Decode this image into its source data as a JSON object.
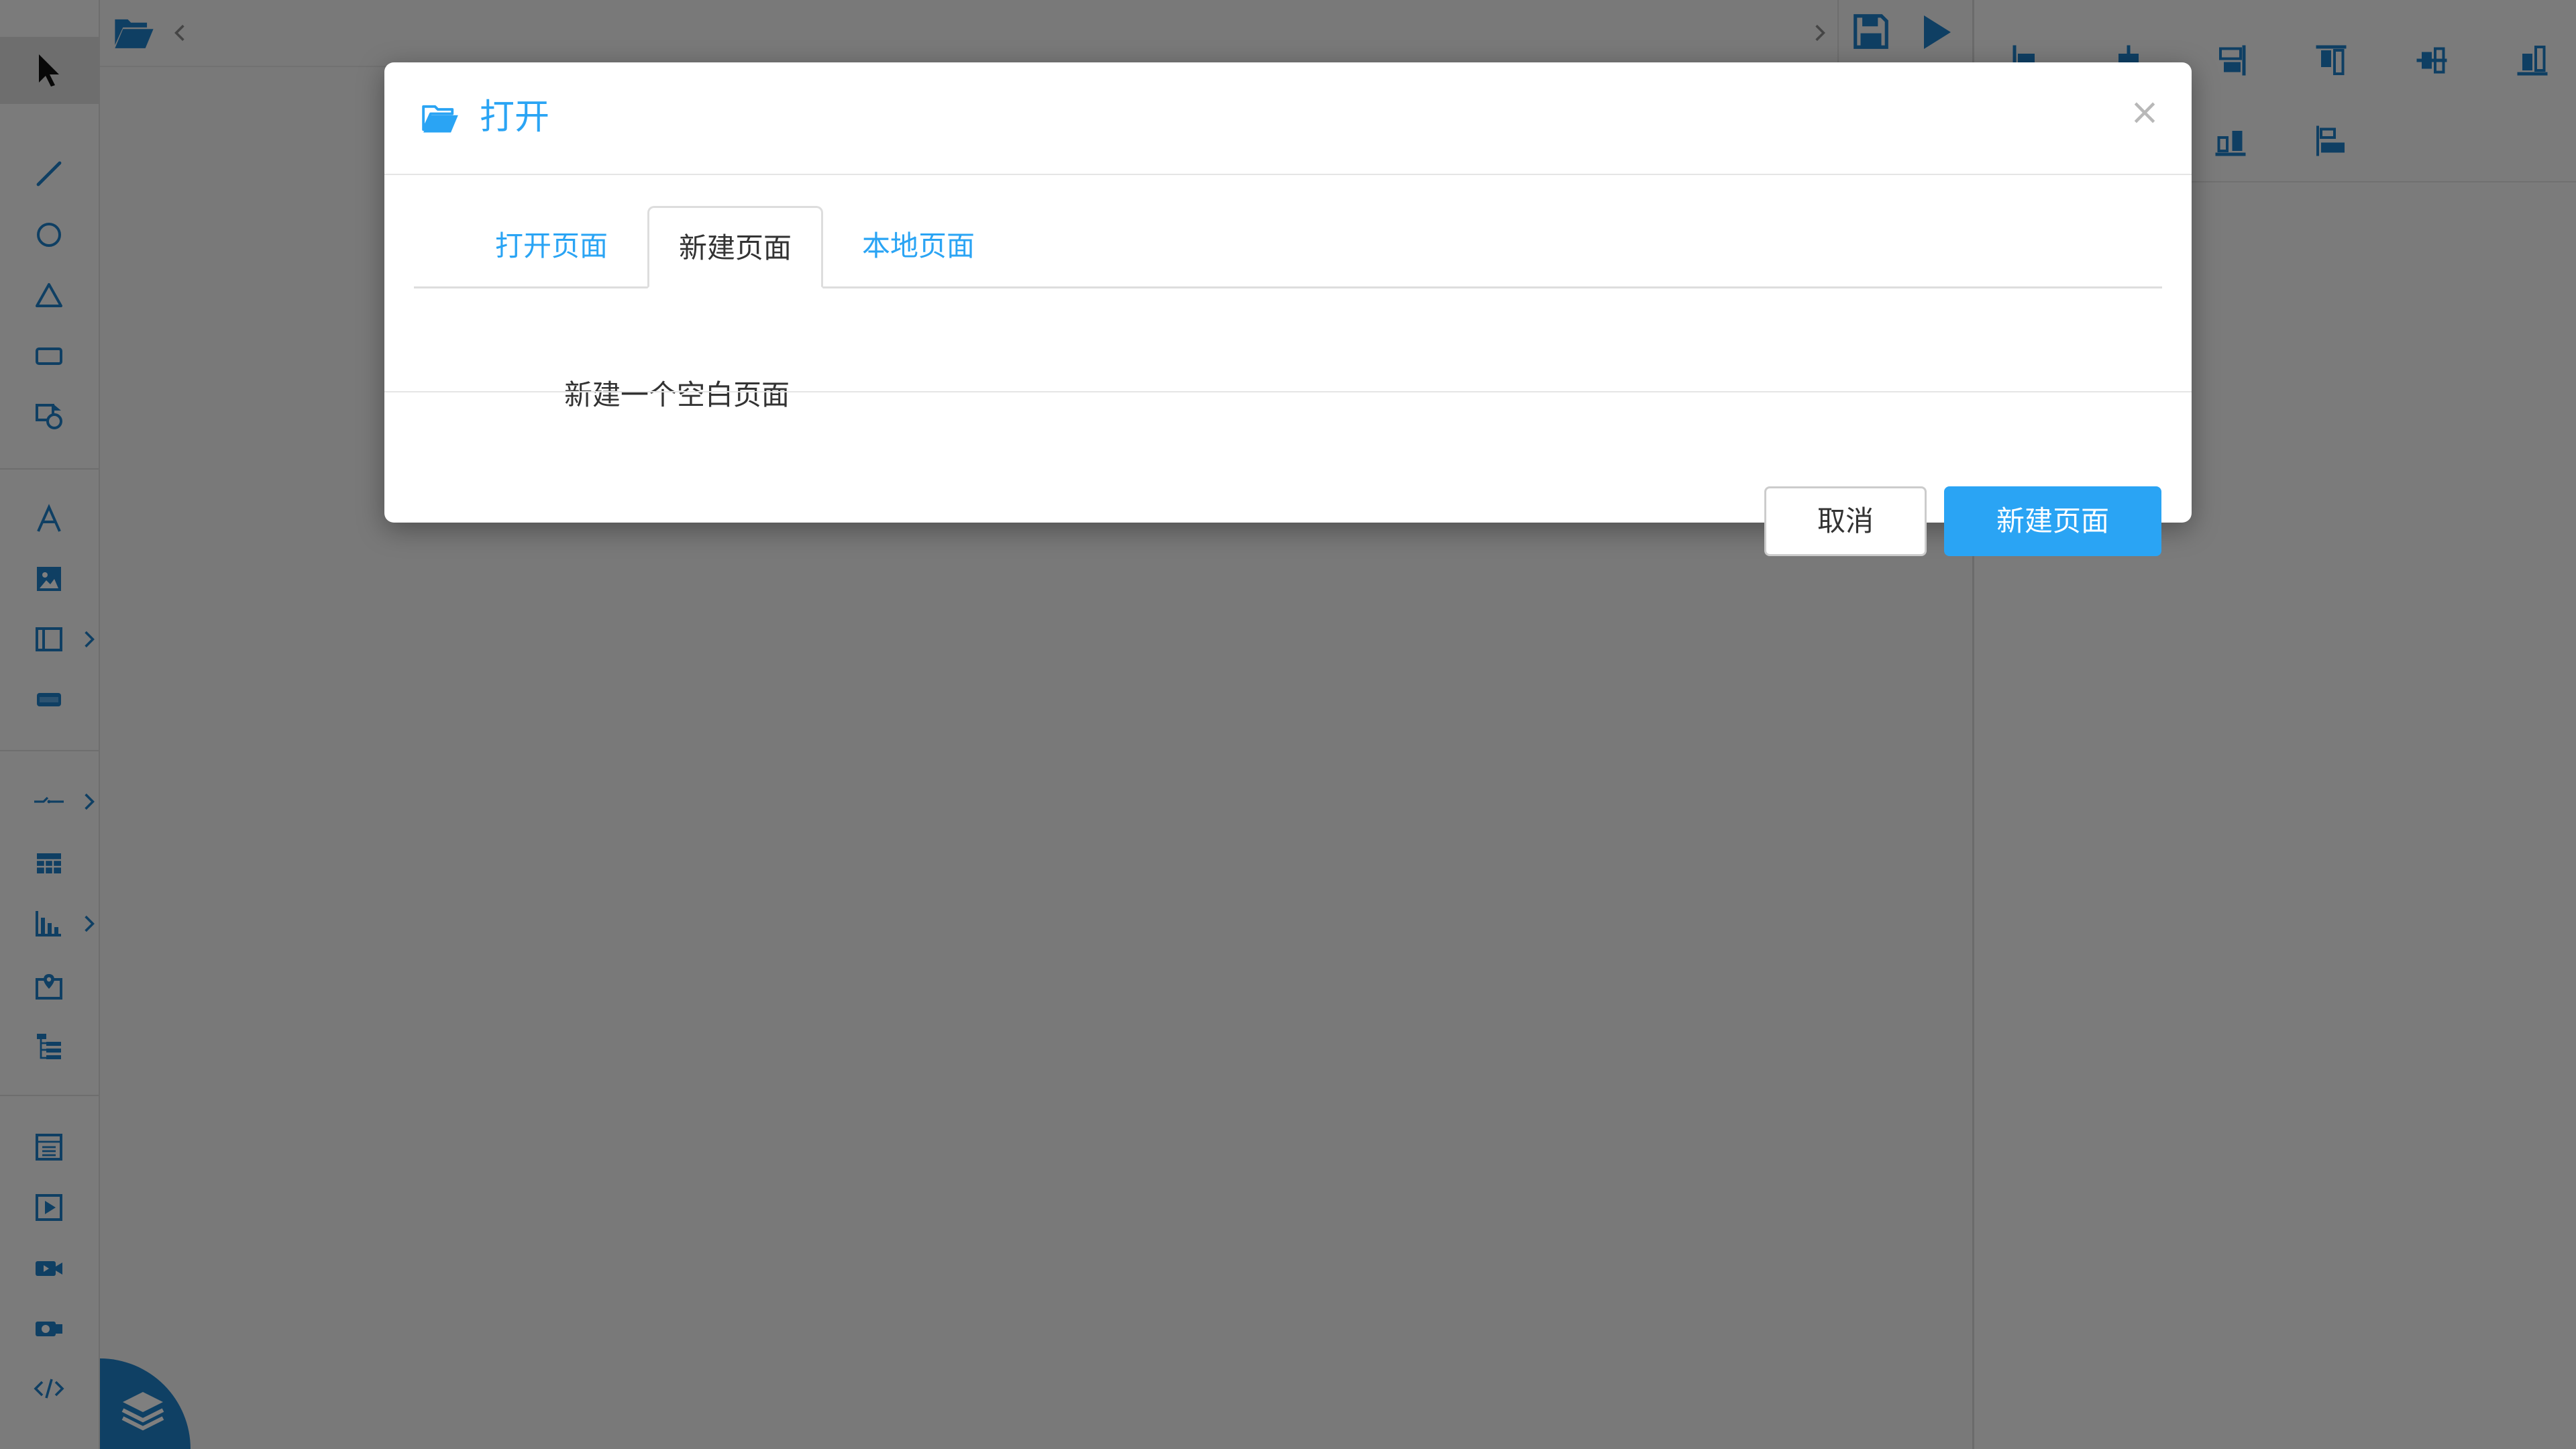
{
  "modal": {
    "title": "打开",
    "close_symbol": "×",
    "tabs": [
      {
        "label": "打开页面",
        "active": false
      },
      {
        "label": "新建页面",
        "active": true
      },
      {
        "label": "本地页面",
        "active": false
      }
    ],
    "body_text": "新建一个空白页面",
    "cancel_label": "取消",
    "confirm_label": "新建页面"
  },
  "colors": {
    "accent": "#2aa4f4",
    "icon_blue": "#1f7fc6",
    "overlay": "rgba(0,0,0,0.5)"
  },
  "left_tools": [
    "select-arrow-icon",
    "line-icon",
    "circle-icon",
    "triangle-icon",
    "rectangle-icon",
    "shapes-icon",
    "text-icon",
    "image-icon",
    "frame-icon",
    "button-shape-icon",
    "connector-icon",
    "table-icon",
    "bar-chart-icon",
    "map-icon",
    "tree-icon",
    "page-icon",
    "video-play-icon",
    "video-camera-icon",
    "camera-icon",
    "code-icon"
  ],
  "top_tools": [
    "open-folder-icon",
    "prev-icon",
    "next-icon",
    "save-icon",
    "play-icon"
  ]
}
